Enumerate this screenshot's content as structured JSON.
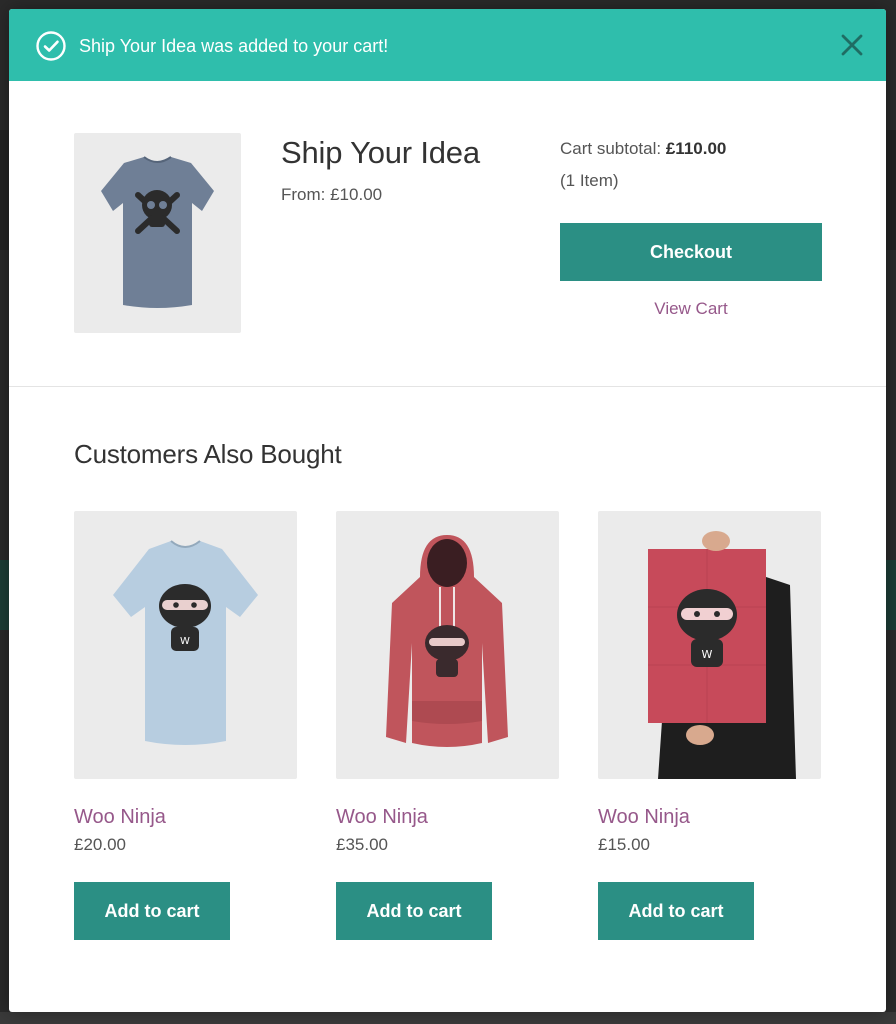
{
  "notice": {
    "message": "Ship Your Idea was added to your cart!",
    "icon": "check-circle-icon",
    "close_icon": "close-icon",
    "bg_color": "#2fbeac"
  },
  "added_product": {
    "title": "Ship Your Idea",
    "price_text": "From: £10.00",
    "image_icon": "tshirt-skull-icon"
  },
  "cart": {
    "subtotal_label": "Cart subtotal:",
    "subtotal_value": "£110.00",
    "item_count": "(1 Item)",
    "checkout_label": "Checkout",
    "view_cart_label": "View Cart"
  },
  "related": {
    "heading": "Customers Also Bought",
    "products": [
      {
        "name": "Woo Ninja",
        "price": "£20.00",
        "button": "Add to cart",
        "image_icon": "tshirt-ninja-icon"
      },
      {
        "name": "Woo Ninja",
        "price": "£35.00",
        "button": "Add to cart",
        "image_icon": "hoodie-ninja-icon"
      },
      {
        "name": "Woo Ninja",
        "price": "£15.00",
        "button": "Add to cart",
        "image_icon": "poster-ninja-icon"
      }
    ]
  },
  "colors": {
    "primary_button": "#2b8f84",
    "link": "#96588a"
  }
}
